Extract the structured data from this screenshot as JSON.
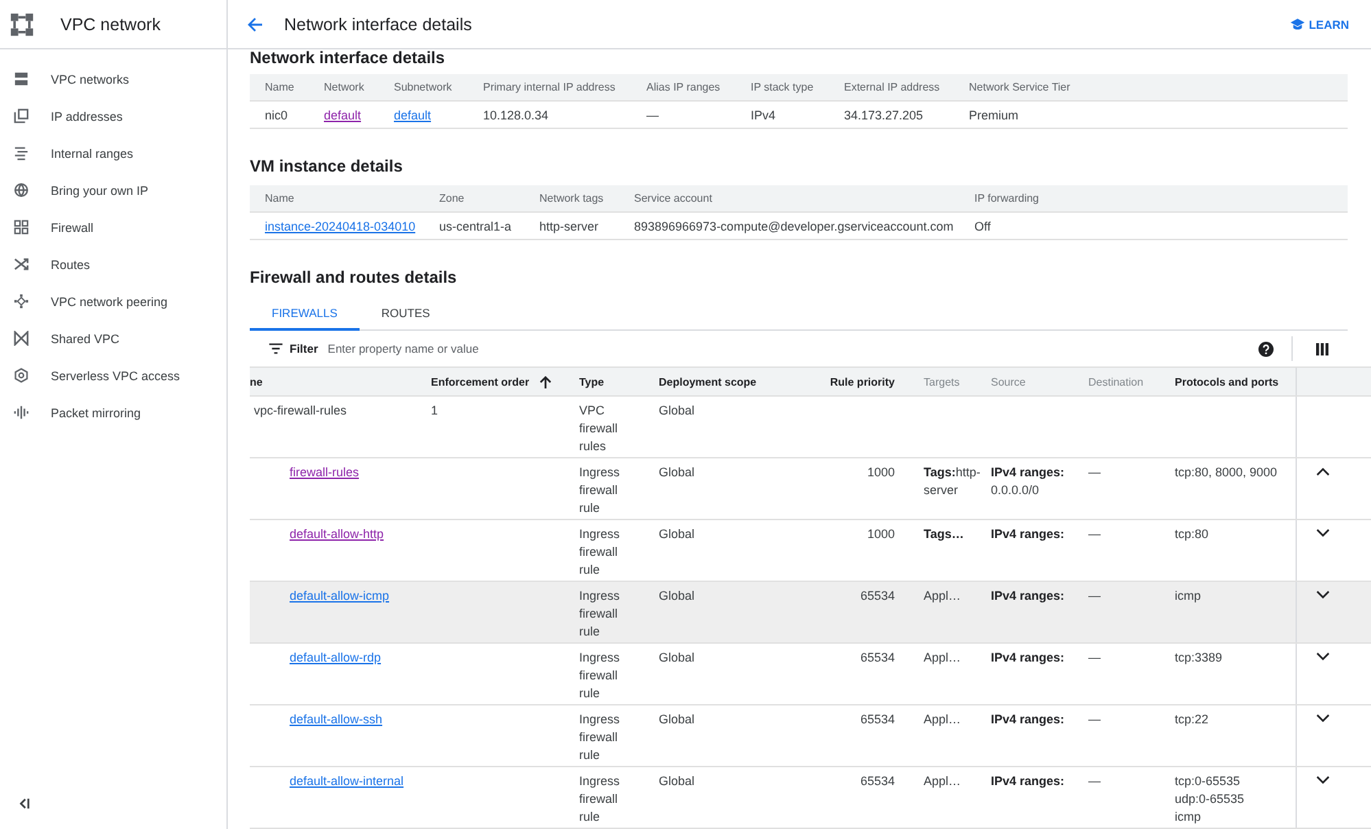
{
  "app": {
    "title": "VPC network"
  },
  "sidebar": {
    "items": [
      "VPC networks",
      "IP addresses",
      "Internal ranges",
      "Bring your own IP",
      "Firewall",
      "Routes",
      "VPC network peering",
      "Shared VPC",
      "Serverless VPC access",
      "Packet mirroring"
    ]
  },
  "page_header": {
    "title": "Network interface details",
    "learn": "LEARN"
  },
  "network_interface": {
    "title": "Network interface details",
    "columns": [
      "Name",
      "Network",
      "Subnetwork",
      "Primary internal IP address",
      "Alias IP ranges",
      "IP stack type",
      "External IP address",
      "Network Service Tier"
    ],
    "rows": [
      [
        {
          "kind": "text",
          "text": "nic0"
        },
        {
          "kind": "link",
          "text": "default",
          "visited": true
        },
        {
          "kind": "link",
          "text": "default",
          "visited": false
        },
        {
          "kind": "text",
          "text": "10.128.0.34"
        },
        {
          "kind": "text",
          "text": "—"
        },
        {
          "kind": "text",
          "text": "IPv4"
        },
        {
          "kind": "text",
          "text": "34.173.27.205"
        },
        {
          "kind": "text",
          "text": "Premium"
        }
      ]
    ]
  },
  "vm_instance": {
    "title": "VM instance details",
    "columns": [
      "Name",
      "Zone",
      "Network tags",
      "Service account",
      "IP forwarding"
    ],
    "rows": [
      [
        {
          "kind": "link",
          "text": "instance-20240418-034010",
          "visited": false
        },
        {
          "kind": "text",
          "text": "us-central1-a"
        },
        {
          "kind": "text",
          "text": "http-server"
        },
        {
          "kind": "text",
          "text": "893896966973-compute@developer.gserviceaccount.com"
        },
        {
          "kind": "text",
          "text": "Off"
        }
      ]
    ]
  },
  "firewall_routes": {
    "title": "Firewall and routes details",
    "tabs": [
      {
        "label": "FIREWALLS",
        "selected": true
      },
      {
        "label": "ROUTES",
        "selected": false
      }
    ],
    "filter": {
      "label": "Filter",
      "placeholder": "Enter property name or value"
    },
    "columns": [
      {
        "label": "ne",
        "dimmed": false,
        "sorted": false
      },
      {
        "label": "Enforcement order",
        "dimmed": false,
        "sorted": true
      },
      {
        "label": "Type",
        "dimmed": false,
        "sorted": false
      },
      {
        "label": "Deployment scope",
        "dimmed": false,
        "sorted": false
      },
      {
        "label": "Rule priority",
        "dimmed": false,
        "sorted": false
      },
      {
        "label": "Targets",
        "dimmed": true,
        "sorted": false
      },
      {
        "label": "Source",
        "dimmed": true,
        "sorted": false
      },
      {
        "label": "Destination",
        "dimmed": true,
        "sorted": false
      },
      {
        "label": "Protocols and ports",
        "dimmed": false,
        "sorted": false
      }
    ],
    "rows": [
      {
        "kind": "policy",
        "name": "vpc-firewall-rules",
        "enforcement_order": "1",
        "type": "VPC firewall rules",
        "scope": "Global",
        "highlighted": false
      },
      {
        "kind": "rule",
        "name": "firewall-rules",
        "visited": true,
        "type": "Ingress firewall rule",
        "scope": "Global",
        "priority": "1000",
        "targets": {
          "label": "Tags:",
          "value": "http-server"
        },
        "source": {
          "label": "IPv4 ranges:",
          "value": "0.0.0.0/0"
        },
        "destination": "—",
        "protocols": [
          "tcp:80, 8000, 9000"
        ],
        "expanded": true,
        "highlighted": false
      },
      {
        "kind": "rule",
        "name": "default-allow-http",
        "visited": true,
        "type": "Ingress firewall rule",
        "scope": "Global",
        "priority": "1000",
        "targets": {
          "label": "Tags…"
        },
        "source": {
          "label": "IPv4 ranges:"
        },
        "destination": "—",
        "protocols": [
          "tcp:80"
        ],
        "expanded": false,
        "highlighted": false
      },
      {
        "kind": "rule",
        "name": "default-allow-icmp",
        "visited": false,
        "type": "Ingress firewall rule",
        "scope": "Global",
        "priority": "65534",
        "targets": {
          "value": "Appl…"
        },
        "source": {
          "label": "IPv4 ranges:"
        },
        "destination": "—",
        "protocols": [
          "icmp"
        ],
        "expanded": false,
        "highlighted": true
      },
      {
        "kind": "rule",
        "name": "default-allow-rdp",
        "visited": false,
        "type": "Ingress firewall rule",
        "scope": "Global",
        "priority": "65534",
        "targets": {
          "value": "Appl…"
        },
        "source": {
          "label": "IPv4 ranges:"
        },
        "destination": "—",
        "protocols": [
          "tcp:3389"
        ],
        "expanded": false,
        "highlighted": false
      },
      {
        "kind": "rule",
        "name": "default-allow-ssh",
        "visited": false,
        "type": "Ingress firewall rule",
        "scope": "Global",
        "priority": "65534",
        "targets": {
          "value": "Appl…"
        },
        "source": {
          "label": "IPv4 ranges:"
        },
        "destination": "—",
        "protocols": [
          "tcp:22"
        ],
        "expanded": false,
        "highlighted": false
      },
      {
        "kind": "rule",
        "name": "default-allow-internal",
        "visited": false,
        "type": "Ingress firewall rule",
        "scope": "Global",
        "priority": "65534",
        "targets": {
          "value": "Appl…"
        },
        "source": {
          "label": "IPv4 ranges:"
        },
        "destination": "—",
        "protocols": [
          "tcp:0-65535",
          "udp:0-65535",
          "icmp"
        ],
        "expanded": false,
        "highlighted": false
      }
    ]
  }
}
